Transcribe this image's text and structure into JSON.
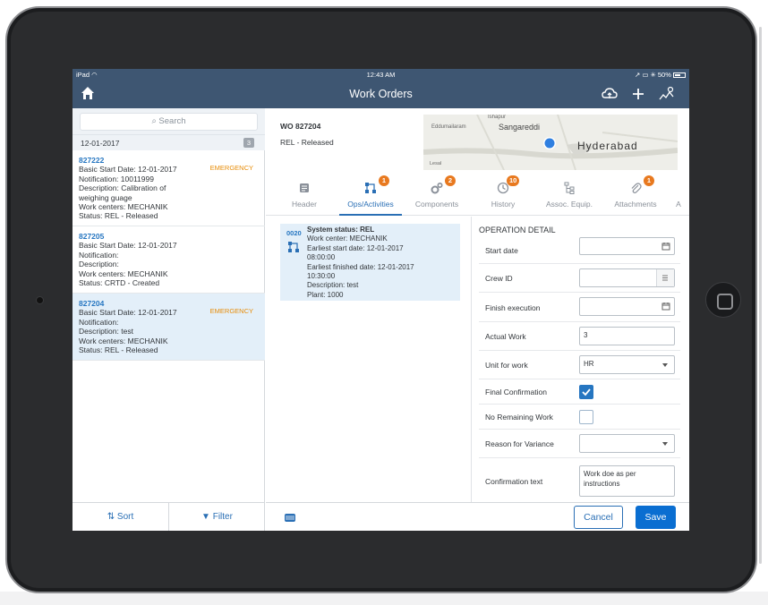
{
  "status_bar": {
    "device": "iPad",
    "time": "12:43 AM",
    "battery": "50%"
  },
  "nav": {
    "title": "Work Orders"
  },
  "list": {
    "search_placeholder": "Search",
    "date_header": "12-01-2017",
    "count": "3",
    "items": [
      {
        "id": "827222",
        "flag": "EMERGENCY",
        "lines": [
          "Basic Start Date: 12-01-2017",
          "Notification: 10011999",
          "Description: Calibration of",
          "weighing guage",
          "Work centers: MECHANIK",
          "Status: REL - Released"
        ]
      },
      {
        "id": "827205",
        "flag": "",
        "lines": [
          "Basic Start Date: 12-01-2017",
          "Notification:",
          "Description:",
          "Work centers: MECHANIK",
          "Status: CRTD - Created"
        ]
      },
      {
        "id": "827204",
        "flag": "EMERGENCY",
        "lines": [
          "Basic Start Date: 12-01-2017",
          "Notification:",
          "Description: test",
          "Work centers: MECHANIK",
          "Status: REL - Released"
        ]
      }
    ],
    "sort_label": "Sort",
    "filter_label": "Filter"
  },
  "detail": {
    "title": "WO 827204",
    "status": "REL - Released",
    "map": {
      "labels": [
        "Ishapur",
        "Eddumailaram",
        "Sangareddi",
        "Hyderabad",
        "Lesal"
      ]
    },
    "tabs": [
      {
        "label": "Header",
        "badge": "",
        "icon": "header-icon"
      },
      {
        "label": "Ops/Activities",
        "badge": "1",
        "icon": "ops-icon"
      },
      {
        "label": "Components",
        "badge": "2",
        "icon": "gears-icon"
      },
      {
        "label": "History",
        "badge": "10",
        "icon": "history-icon"
      },
      {
        "label": "Assoc. Equip.",
        "badge": "",
        "icon": "hierarchy-icon"
      },
      {
        "label": "Attachments",
        "badge": "1",
        "icon": "paperclip-icon"
      },
      {
        "label": "A",
        "badge": "",
        "icon": ""
      }
    ],
    "operation": {
      "number": "0020",
      "lines": [
        "System status: REL",
        "Work center: MECHANIK",
        "Earliest start date: 12-01-2017",
        "08:00:00",
        "Earliest finished date: 12-01-2017",
        "10:30:00",
        "Description: test",
        "Plant: 1000"
      ]
    },
    "operation_detail": {
      "title": "OPERATION DETAIL",
      "start_date_label": "Start date",
      "start_date_value": "",
      "crew_id_label": "Crew ID",
      "crew_id_value": "",
      "finish_execution_label": "Finish execution",
      "finish_execution_value": "",
      "actual_work_label": "Actual Work",
      "actual_work_value": "3",
      "unit_label": "Unit for work",
      "unit_value": "HR",
      "final_confirmation_label": "Final Confirmation",
      "final_confirmation_checked": true,
      "no_remaining_label": "No Remaining Work",
      "no_remaining_checked": false,
      "reason_label": "Reason for Variance",
      "reason_value": "",
      "confirmation_text_label": "Confirmation text",
      "confirmation_text_value": "Work doe as per instructions"
    },
    "cancel_label": "Cancel",
    "save_label": "Save"
  },
  "colors": {
    "nav": "#3e5672",
    "accent": "#2a6fb5",
    "badge": "#e8791f",
    "emergency": "#e78c07",
    "selected": "#e3eff9"
  }
}
